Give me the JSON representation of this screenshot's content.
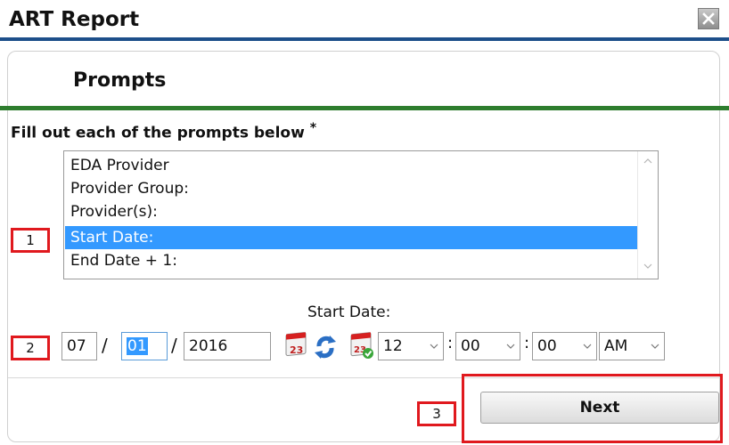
{
  "window": {
    "title": "ART Report",
    "close_icon": "close-icon"
  },
  "section": {
    "title": "Prompts",
    "instruction": "Fill out each of the prompts below",
    "required_marker": "*"
  },
  "prompt_list": {
    "items": [
      {
        "label": "EDA Provider",
        "selected": false
      },
      {
        "label": "Provider Group:",
        "selected": false
      },
      {
        "label": "Provider(s):",
        "selected": false
      },
      {
        "label": "Start Date:",
        "selected": true
      },
      {
        "label": "End Date + 1:",
        "selected": false
      }
    ]
  },
  "date_entry": {
    "caption": "Start Date:",
    "month": "07",
    "day": "01",
    "year": "2016",
    "separator": "/",
    "hour": "12",
    "minute": "00",
    "second": "00",
    "meridiem": "AM",
    "time_separator": ":"
  },
  "annotations": [
    "1",
    "2",
    "3"
  ],
  "actions": {
    "next_label": "Next"
  },
  "colors": {
    "header_rule": "#1d4f8a",
    "green_rule": "#2e7d2e",
    "selection": "#3399ff",
    "annotation_red": "#e0191e"
  }
}
